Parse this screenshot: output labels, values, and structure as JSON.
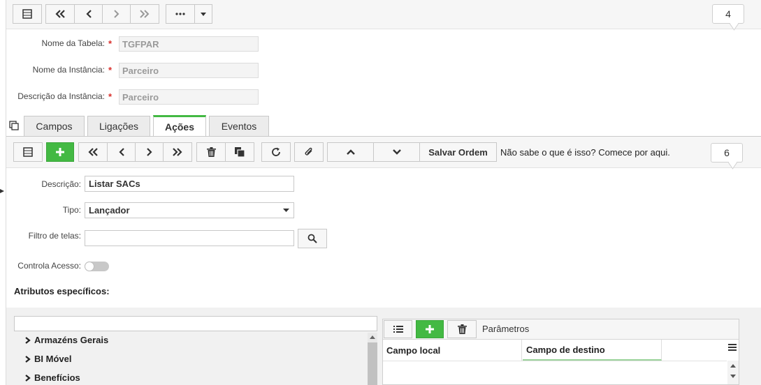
{
  "top_counter": "4",
  "form": {
    "table_name_label": "Nome da Tabela:",
    "table_name_value": "TGFPAR",
    "instance_name_label": "Nome da Instância:",
    "instance_name_value": "Parceiro",
    "instance_desc_label": "Descrição da Instância:",
    "instance_desc_value": "Parceiro",
    "required_mark": "*"
  },
  "tabs": [
    {
      "label": "Campos"
    },
    {
      "label": "Ligações"
    },
    {
      "label": "Ações"
    },
    {
      "label": "Eventos"
    }
  ],
  "actions_toolbar": {
    "save_order_label": "Salvar Ordem",
    "help_text": "Não sabe o que é isso? Comece por aqui.",
    "counter": "6"
  },
  "action_form": {
    "description_label": "Descrição:",
    "description_value": "Listar SACs",
    "type_label": "Tipo:",
    "type_value": "Lançador",
    "screen_filter_label": "Filtro de telas:",
    "screen_filter_value": "",
    "access_control_label": "Controla Acesso:",
    "specific_attrs_label": "Atributos específicos:"
  },
  "tree": {
    "items": [
      {
        "label": "Armazéns Gerais"
      },
      {
        "label": "BI Móvel"
      },
      {
        "label": "Benefícios"
      }
    ]
  },
  "params": {
    "title": "Parâmetros",
    "col_local": "Campo local",
    "col_dest": "Campo de destino"
  },
  "colors": {
    "accent_green": "#43b943",
    "required_red": "#d9302c"
  }
}
